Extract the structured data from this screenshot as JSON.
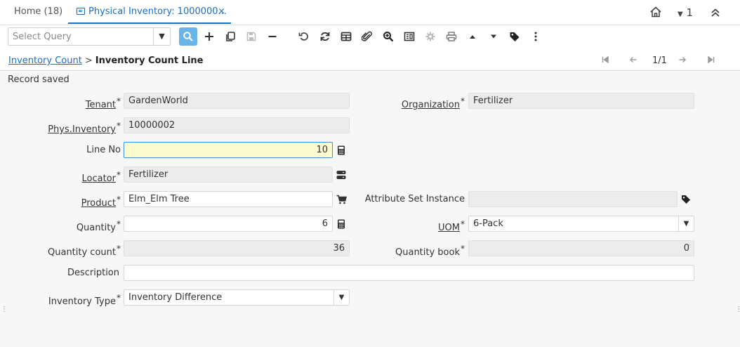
{
  "tabs": {
    "home_label": "Home (18)",
    "active_label": "Physical Inventory: 1000000...",
    "close_glyph": "×"
  },
  "header": {
    "home_icon": "house-icon",
    "user_badge": "1",
    "collapse_icon": "double-chevron-up-icon"
  },
  "toolbar": {
    "query_placeholder": "Select Query",
    "buttons": [
      "search-icon",
      "new-record-icon",
      "copy-icon",
      "save-icon",
      "delete-icon",
      "undo-icon",
      "refresh-icon",
      "grid-toggle-icon",
      "attachment-icon",
      "zoom-icon",
      "report-icon",
      "process-gear-icon",
      "print-icon",
      "previous-record-icon",
      "next-record-icon",
      "tag-icon",
      "more-menu-icon"
    ]
  },
  "breadcrumb": {
    "parent": "Inventory Count",
    "separator": ">",
    "current": "Inventory Count Line"
  },
  "navigation": {
    "record_counter": "1/1"
  },
  "form": {
    "status": "Record saved",
    "tenant": {
      "label": "Tenant",
      "value": "GardenWorld"
    },
    "organization": {
      "label": "Organization",
      "value": "Fertilizer"
    },
    "phys_inventory": {
      "label": "Phys.Inventory",
      "value": "10000002"
    },
    "line_no": {
      "label": "Line No",
      "value": "10"
    },
    "locator": {
      "label": "Locator",
      "value": "Fertilizer"
    },
    "product": {
      "label": "Product",
      "value": "Elm_Elm Tree"
    },
    "attribute_set_instance": {
      "label": "Attribute Set Instance",
      "value": ""
    },
    "quantity": {
      "label": "Quantity",
      "value": "6"
    },
    "uom": {
      "label": "UOM",
      "value": "6-Pack"
    },
    "quantity_count": {
      "label": "Quantity count",
      "value": "36"
    },
    "quantity_book": {
      "label": "Quantity book",
      "value": "0"
    },
    "description": {
      "label": "Description",
      "value": ""
    },
    "inventory_type": {
      "label": "Inventory Type",
      "value": "Inventory Difference"
    },
    "required_mark": "*"
  },
  "colors": {
    "accent": "#1b6fc0",
    "search_button": "#69b4e8",
    "focused_field": "#fdfbd0",
    "readonly_field": "#ececec"
  }
}
